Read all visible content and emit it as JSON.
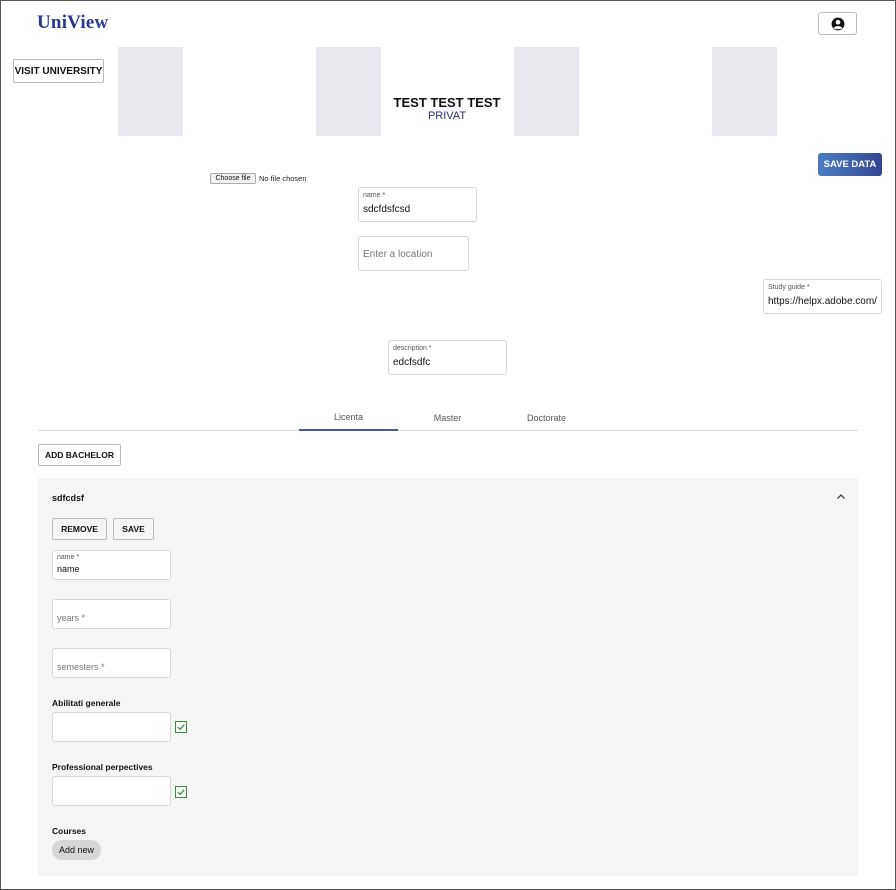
{
  "header": {
    "logo": "UniView",
    "account_icon": "account-circle-icon"
  },
  "toolbar": {
    "visit_label": "VISIT UNIVERSITY",
    "save_data_label": "SAVE DATA"
  },
  "university": {
    "title": "TEST TEST TEST",
    "type": "PRIVAT"
  },
  "file_upload": {
    "button_label": "Choose file",
    "status": "No file chosen"
  },
  "form": {
    "name": {
      "label": "name *",
      "value": "sdcfdsfcsd"
    },
    "location": {
      "placeholder": "Enter a location"
    },
    "study_guide": {
      "label": "Study guide *",
      "value": "https://helpx.adobe.com/"
    },
    "description": {
      "label": "description *",
      "value": "edcfsdfc"
    }
  },
  "tabs": [
    {
      "label": "Licenta",
      "active": true
    },
    {
      "label": "Master",
      "active": false
    },
    {
      "label": "Doctorate",
      "active": false
    }
  ],
  "add_bachelor_label": "ADD BACHELOR",
  "program": {
    "title": "sdfcdsf",
    "remove_label": "REMOVE",
    "save_label": "SAVE",
    "name": {
      "label": "name *",
      "value": "name"
    },
    "years": {
      "placeholder": "years *"
    },
    "semesters": {
      "placeholder": "semesters *"
    },
    "abilities_label": "Abilitati generale",
    "perspectives_label": "Professional perpectives",
    "courses_label": "Courses",
    "add_new_label": "Add new"
  },
  "colors": {
    "brand": "#2c3a8c",
    "accent": "#4a57a8",
    "check_green": "#3a8a3a"
  }
}
